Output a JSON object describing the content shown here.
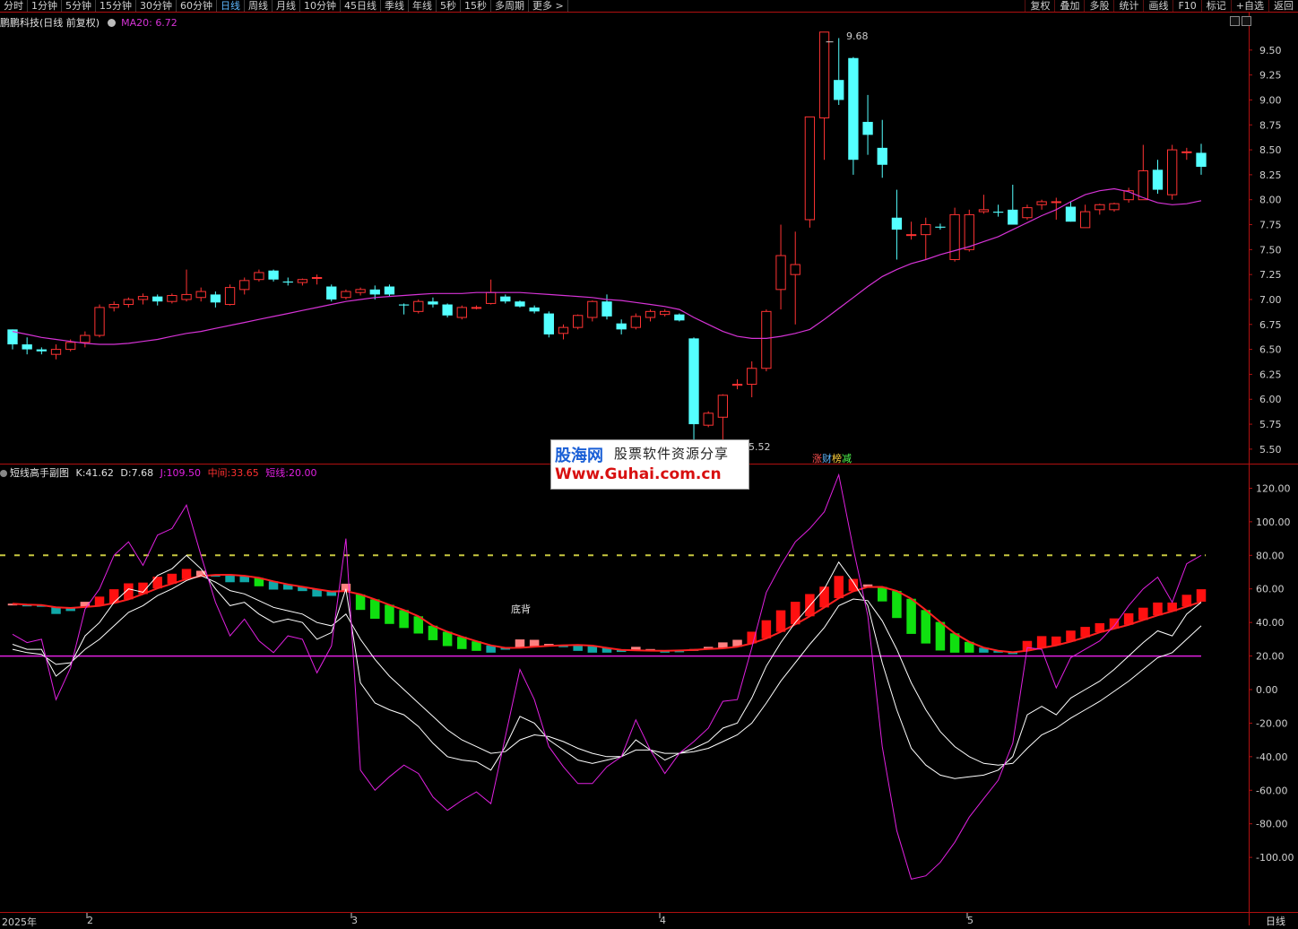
{
  "toolbar": {
    "period_tabs": [
      "分时",
      "1分钟",
      "5分钟",
      "15分钟",
      "30分钟",
      "60分钟",
      "日线",
      "周线",
      "月线",
      "10分钟",
      "45日线",
      "季线",
      "年线",
      "5秒",
      "15秒",
      "多周期",
      "更多 >"
    ],
    "active_tab": "日线",
    "right_tools": [
      "复权",
      "叠加",
      "多股",
      "统计",
      "画线",
      "F10",
      "标记",
      "+自选",
      "返回"
    ]
  },
  "main_panel": {
    "title": "鹏鹏科技(日线 前复权)",
    "ma_label": "MA20:",
    "ma_value": "6.72",
    "high_label": "9.68",
    "low_label": "5.52",
    "tags": [
      "涨",
      "财",
      "榜",
      "减"
    ],
    "y_ticks": [
      "9.50",
      "9.25",
      "9.00",
      "8.75",
      "8.50",
      "8.25",
      "8.00",
      "7.75",
      "7.50",
      "7.25",
      "7.00",
      "6.75",
      "6.50",
      "6.25",
      "6.00",
      "5.75",
      "5.50"
    ]
  },
  "sub_panel": {
    "title": "短线高手副图",
    "k_label": "K:",
    "k_value": "41.62",
    "d_label": "D:",
    "d_value": "7.68",
    "j_label": "J:",
    "j_value": "109.50",
    "mid_label": "中间:",
    "mid_value": "33.65",
    "short_label": "短线:",
    "short_value": "20.00",
    "annotation": "底背",
    "y_ticks": [
      "120.00",
      "100.00",
      "80.00",
      "60.00",
      "40.00",
      "20.00",
      "0.00",
      "-20.00",
      "-40.00",
      "-60.00",
      "-80.00",
      "-100.00"
    ]
  },
  "x_axis": {
    "labels": [
      "2025年",
      "2",
      "3",
      "4",
      "5"
    ],
    "corner_label": "日线"
  },
  "watermark": {
    "brand": "股海网",
    "slogan": "股票软件资源分享",
    "url": "Www.Guhai.com.cn"
  },
  "colors": {
    "up": "#ff3333",
    "down": "#54ffff",
    "ma": "#d633d6",
    "mid_line": "#ff2020",
    "short_line": "#e020e0",
    "bar_red": "#ff1010",
    "bar_pink": "#ff8080",
    "bar_green": "#10e010",
    "bar_teal": "#10a8a8",
    "axis": "#b01010"
  },
  "chart_data": [
    {
      "type": "candlestick",
      "y_unit": "price",
      "ylim": [
        5.4,
        9.75
      ],
      "ma20_last": 6.72,
      "ohlc": [
        [
          6.7,
          6.7,
          6.5,
          6.55
        ],
        [
          6.55,
          6.62,
          6.45,
          6.5
        ],
        [
          6.5,
          6.52,
          6.45,
          6.48
        ],
        [
          6.45,
          6.55,
          6.4,
          6.5
        ],
        [
          6.5,
          6.6,
          6.48,
          6.57
        ],
        [
          6.57,
          6.68,
          6.52,
          6.64
        ],
        [
          6.64,
          6.95,
          6.62,
          6.92
        ],
        [
          6.92,
          6.98,
          6.88,
          6.95
        ],
        [
          6.95,
          7.02,
          6.92,
          7.0
        ],
        [
          7.0,
          7.06,
          6.95,
          7.03
        ],
        [
          7.03,
          7.05,
          6.94,
          6.98
        ],
        [
          6.98,
          7.06,
          6.96,
          7.04
        ],
        [
          7.0,
          7.3,
          6.98,
          7.05
        ],
        [
          7.02,
          7.12,
          6.98,
          7.08
        ],
        [
          7.05,
          7.08,
          6.92,
          6.97
        ],
        [
          6.95,
          7.15,
          6.94,
          7.12
        ],
        [
          7.1,
          7.22,
          7.05,
          7.19
        ],
        [
          7.2,
          7.3,
          7.18,
          7.27
        ],
        [
          7.29,
          7.3,
          7.18,
          7.2
        ],
        [
          7.18,
          7.22,
          7.14,
          7.17
        ],
        [
          7.17,
          7.21,
          7.14,
          7.2
        ],
        [
          7.22,
          7.25,
          7.15,
          7.22
        ],
        [
          7.13,
          7.15,
          6.98,
          7.0
        ],
        [
          7.02,
          7.1,
          7.0,
          7.08
        ],
        [
          7.07,
          7.12,
          7.04,
          7.1
        ],
        [
          7.1,
          7.14,
          7.0,
          7.05
        ],
        [
          7.13,
          7.15,
          7.03,
          7.05
        ],
        [
          6.95,
          6.96,
          6.85,
          6.94
        ],
        [
          6.88,
          7.0,
          6.86,
          6.98
        ],
        [
          6.98,
          7.02,
          6.92,
          6.95
        ],
        [
          6.95,
          6.96,
          6.82,
          6.84
        ],
        [
          6.82,
          6.94,
          6.8,
          6.92
        ],
        [
          6.92,
          6.94,
          6.9,
          6.92
        ],
        [
          6.96,
          7.2,
          6.95,
          7.07
        ],
        [
          7.03,
          7.05,
          6.96,
          6.98
        ],
        [
          6.98,
          6.99,
          6.92,
          6.93
        ],
        [
          6.92,
          6.94,
          6.86,
          6.88
        ],
        [
          6.86,
          6.88,
          6.62,
          6.65
        ],
        [
          6.66,
          6.75,
          6.6,
          6.72
        ],
        [
          6.72,
          6.85,
          6.7,
          6.84
        ],
        [
          6.82,
          6.99,
          6.78,
          6.98
        ],
        [
          6.98,
          7.05,
          6.8,
          6.83
        ],
        [
          6.76,
          6.8,
          6.65,
          6.7
        ],
        [
          6.72,
          6.86,
          6.7,
          6.83
        ],
        [
          6.82,
          6.9,
          6.78,
          6.88
        ],
        [
          6.85,
          6.9,
          6.83,
          6.88
        ],
        [
          6.85,
          6.86,
          6.78,
          6.79
        ],
        [
          6.61,
          6.62,
          5.55,
          5.75
        ],
        [
          5.74,
          5.88,
          5.72,
          5.86
        ],
        [
          5.82,
          6.05,
          5.55,
          6.04
        ],
        [
          6.14,
          6.2,
          6.1,
          6.15
        ],
        [
          6.15,
          6.38,
          6.02,
          6.31
        ],
        [
          6.31,
          6.9,
          6.28,
          6.88
        ],
        [
          7.1,
          7.75,
          6.9,
          7.44
        ],
        [
          7.25,
          7.68,
          6.75,
          7.35
        ],
        [
          7.8,
          8.82,
          7.72,
          8.83
        ],
        [
          8.82,
          9.6,
          8.4,
          9.68
        ],
        [
          9.2,
          9.62,
          8.95,
          9.0
        ],
        [
          9.42,
          9.43,
          8.25,
          8.4
        ],
        [
          8.78,
          9.05,
          8.45,
          8.65
        ],
        [
          8.52,
          8.8,
          8.22,
          8.35
        ],
        [
          7.82,
          8.1,
          7.4,
          7.7
        ],
        [
          7.65,
          7.78,
          7.6,
          7.65
        ],
        [
          7.65,
          7.82,
          7.4,
          7.75
        ],
        [
          7.73,
          7.76,
          7.7,
          7.72
        ],
        [
          7.4,
          7.92,
          7.38,
          7.85
        ],
        [
          7.5,
          7.9,
          7.48,
          7.85
        ],
        [
          7.88,
          8.05,
          7.86,
          7.9
        ],
        [
          7.88,
          7.95,
          7.83,
          7.87
        ],
        [
          7.9,
          8.15,
          7.75,
          7.75
        ],
        [
          7.82,
          7.95,
          7.8,
          7.92
        ],
        [
          7.95,
          8.0,
          7.9,
          7.98
        ],
        [
          7.98,
          8.02,
          7.8,
          7.98
        ],
        [
          7.93,
          7.98,
          7.78,
          7.78
        ],
        [
          7.72,
          7.95,
          7.72,
          7.88
        ],
        [
          7.9,
          7.96,
          7.85,
          7.95
        ],
        [
          7.9,
          7.97,
          7.88,
          7.96
        ],
        [
          8.0,
          8.12,
          7.97,
          8.09
        ],
        [
          8.0,
          8.55,
          8.0,
          8.29
        ],
        [
          8.3,
          8.4,
          8.06,
          8.1
        ],
        [
          8.05,
          8.55,
          8.0,
          8.5
        ],
        [
          8.48,
          8.52,
          8.4,
          8.48
        ],
        [
          8.47,
          8.56,
          8.25,
          8.33
        ]
      ],
      "ma20": [
        6.68,
        6.65,
        6.62,
        6.6,
        6.58,
        6.56,
        6.55,
        6.55,
        6.56,
        6.58,
        6.6,
        6.63,
        6.66,
        6.68,
        6.71,
        6.74,
        6.77,
        6.8,
        6.83,
        6.86,
        6.89,
        6.92,
        6.95,
        6.98,
        7.0,
        7.02,
        7.03,
        7.04,
        7.05,
        7.06,
        7.06,
        7.06,
        7.07,
        7.07,
        7.07,
        7.07,
        7.06,
        7.05,
        7.04,
        7.03,
        7.02,
        7.0,
        6.99,
        6.97,
        6.95,
        6.93,
        6.9,
        6.82,
        6.75,
        6.68,
        6.63,
        6.61,
        6.61,
        6.63,
        6.66,
        6.7,
        6.8,
        6.91,
        7.02,
        7.13,
        7.23,
        7.3,
        7.36,
        7.4,
        7.45,
        7.49,
        7.53,
        7.58,
        7.63,
        7.7,
        7.77,
        7.84,
        7.9,
        7.98,
        8.05,
        8.09,
        8.11,
        8.08,
        8.02,
        7.97,
        7.95,
        7.96,
        7.99
      ]
    },
    {
      "type": "line",
      "y_unit": "indicator",
      "ylim": [
        -132,
        132
      ],
      "short_line": 20,
      "reference_line": 80,
      "k": [
        27,
        24,
        24,
        8,
        15,
        32,
        40,
        52,
        60,
        58,
        68,
        72,
        80,
        72,
        60,
        50,
        52,
        45,
        40,
        42,
        40,
        30,
        34,
        60,
        4,
        -8,
        -12,
        -15,
        -22,
        -32,
        -40,
        -42,
        -43,
        -48,
        -34,
        -16,
        -20,
        -30,
        -36,
        -42,
        -44,
        -42,
        -40,
        -30,
        -36,
        -42,
        -38,
        -35,
        -31,
        -23,
        -20,
        -5,
        14,
        28,
        40,
        50,
        60,
        76,
        64,
        50,
        16,
        -12,
        -35,
        -45,
        -51,
        -53,
        -52,
        -51,
        -48,
        -40,
        -15,
        -10,
        -15,
        -5,
        0,
        5,
        12,
        20,
        28,
        35,
        32,
        45,
        52
      ],
      "d": [
        24,
        22,
        21,
        15,
        16,
        24,
        30,
        38,
        46,
        50,
        56,
        60,
        65,
        68,
        64,
        59,
        57,
        53,
        49,
        47,
        45,
        40,
        38,
        45,
        30,
        18,
        8,
        0,
        -8,
        -16,
        -24,
        -30,
        -34,
        -38,
        -37,
        -30,
        -27,
        -28,
        -31,
        -35,
        -38,
        -40,
        -40,
        -36,
        -36,
        -38,
        -38,
        -37,
        -35,
        -31,
        -27,
        -20,
        -8,
        5,
        16,
        27,
        37,
        50,
        54,
        53,
        41,
        24,
        4,
        -12,
        -25,
        -34,
        -40,
        -44,
        -45,
        -44,
        -35,
        -27,
        -23,
        -17,
        -12,
        -7,
        -1,
        5,
        12,
        19,
        22,
        30,
        38
      ]
    }
  ]
}
